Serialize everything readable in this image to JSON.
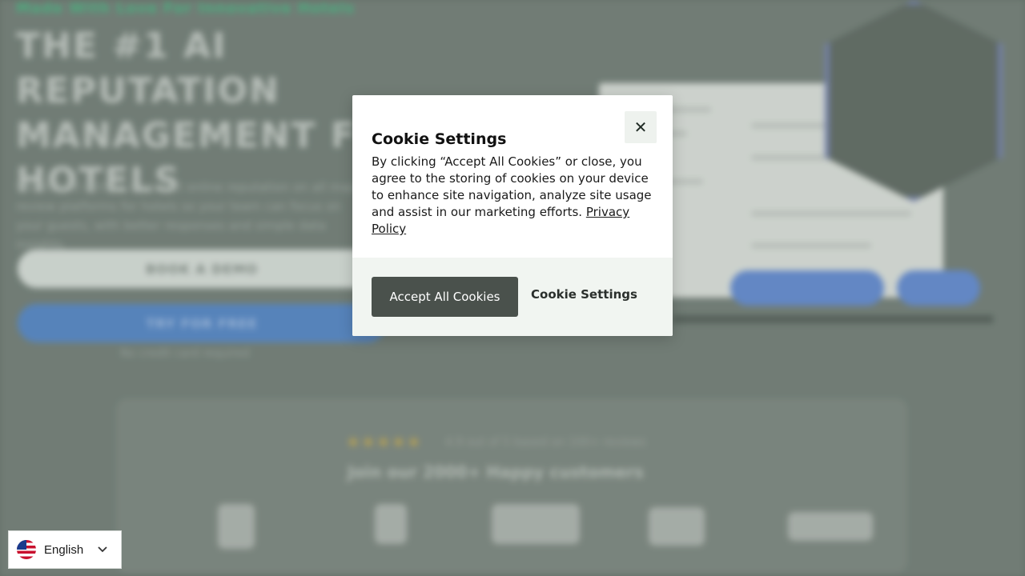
{
  "background": {
    "toptag": "Made With Love For Innovative Hotels",
    "headline": "THE #1 AI REPUTATION MANAGEMENT FOR HOTELS",
    "paragraph": "We do and deliver a perfect online reputation on all major review platforms for hotels so your team can focus on your guests, with better responses and simple data insights.",
    "book_demo_label": "BOOK A DEMO",
    "try_free_label": "TRY FOR FREE",
    "no_card_text": "No credit card required",
    "stars": "★★★★★",
    "rating_text": "4.9 out of 5 based on 100+ reviews",
    "join_text": "Join our 2000+ Happy customers"
  },
  "cookie_modal": {
    "title": "Cookie Settings",
    "body": "By clicking “Accept All Cookies” or close, you agree to the storing of cookies on your device to enhance site navigation, analyze site usage and assist in our marketing efforts.",
    "privacy_link": "Privacy Policy",
    "accept_label": "Accept All Cookies",
    "settings_label": "Cookie Settings",
    "close_glyph": "✕"
  },
  "language_selector": {
    "label": "English",
    "chevron": "⌄"
  },
  "colors": {
    "accept_button_bg": "#4a514c",
    "footer_bg": "#f1f5f1",
    "brand_green": "#4fbf8a",
    "brand_blue": "#5d8fcf"
  }
}
